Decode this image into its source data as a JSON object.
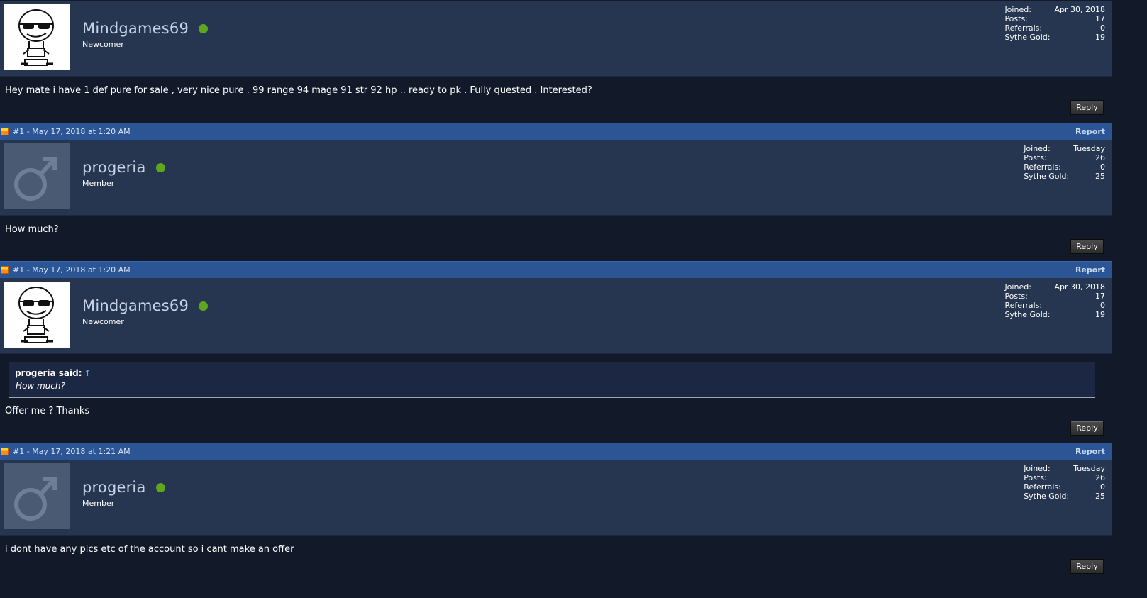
{
  "posts": [
    {
      "header": null,
      "username": "Mindgames69",
      "rank": "Newcomer",
      "avatar": "sunglasses-meme-avatar",
      "stats": {
        "joined_label": "Joined:",
        "joined": "Apr 30, 2018",
        "posts_label": "Posts:",
        "posts": "17",
        "referrals_label": "Referrals:",
        "referrals": "0",
        "gold_label": "Sythe Gold:",
        "gold": "19"
      },
      "message": "Hey mate i have 1 def pure for sale , very nice pure . 99 range 94 mage 91 str 92 hp .. ready to pk . Fully quested . Interested?",
      "reply_label": "Reply"
    },
    {
      "header": {
        "meta": "#1 - May 17, 2018 at 1:20 AM",
        "report": "Report"
      },
      "username": "progeria",
      "rank": "Member",
      "avatar": "default-male-avatar",
      "stats": {
        "joined_label": "Joined:",
        "joined": "Tuesday",
        "posts_label": "Posts:",
        "posts": "26",
        "referrals_label": "Referrals:",
        "referrals": "0",
        "gold_label": "Sythe Gold:",
        "gold": "25"
      },
      "message": "How much?",
      "reply_label": "Reply"
    },
    {
      "header": {
        "meta": "#1 - May 17, 2018 at 1:20 AM",
        "report": "Report"
      },
      "username": "Mindgames69",
      "rank": "Newcomer",
      "avatar": "sunglasses-meme-avatar",
      "stats": {
        "joined_label": "Joined:",
        "joined": "Apr 30, 2018",
        "posts_label": "Posts:",
        "posts": "17",
        "referrals_label": "Referrals:",
        "referrals": "0",
        "gold_label": "Sythe Gold:",
        "gold": "19"
      },
      "quote": {
        "author": "progeria said:",
        "arrow": "↑",
        "text": "How much?"
      },
      "message": "Offer me ? Thanks",
      "reply_label": "Reply"
    },
    {
      "header": {
        "meta": "#1 - May 17, 2018 at 1:21 AM",
        "report": "Report"
      },
      "username": "progeria",
      "rank": "Member",
      "avatar": "default-male-avatar",
      "stats": {
        "joined_label": "Joined:",
        "joined": "Tuesday",
        "posts_label": "Posts:",
        "posts": "26",
        "referrals_label": "Referrals:",
        "referrals": "0",
        "gold_label": "Sythe Gold:",
        "gold": "25"
      },
      "message": "i dont have any pics etc of the account so i cant make an offer",
      "reply_label": "Reply"
    }
  ],
  "colors": {
    "header_bar": "#2c5596",
    "user_bar": "#263650",
    "body": "#121a2a",
    "online": "#5ea71c"
  }
}
